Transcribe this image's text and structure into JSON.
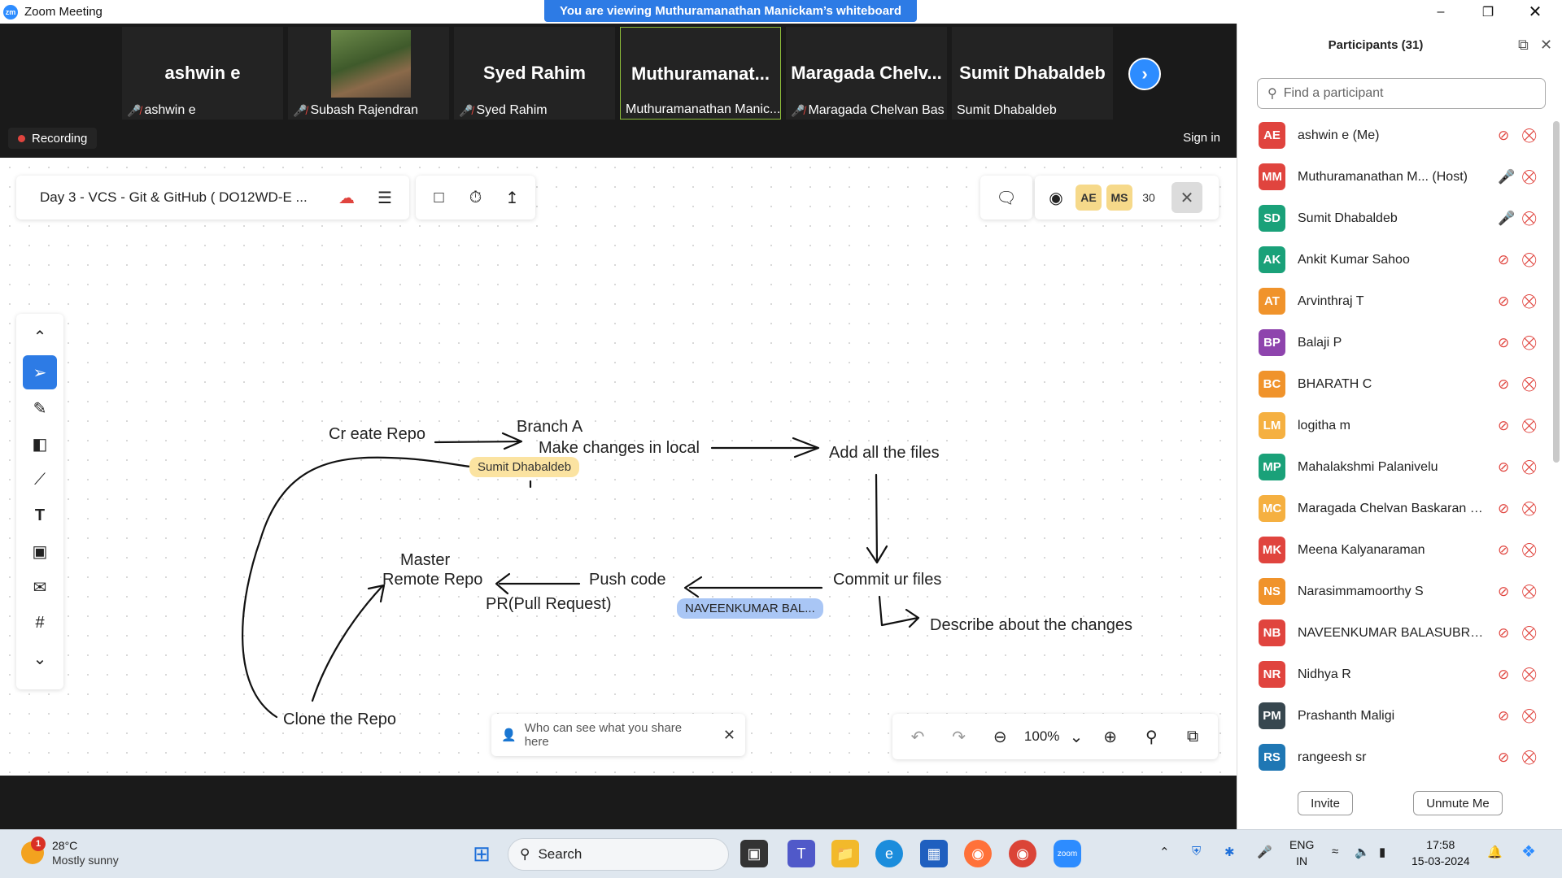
{
  "window": {
    "app_title": "Zoom Meeting",
    "banner": "You are viewing Muthuramanathan Manickam’s whiteboard"
  },
  "video_strip": {
    "tiles": [
      {
        "big": "ashwin e",
        "small": "ashwin e",
        "muted": true
      },
      {
        "big": "",
        "small": "Subash Rajendran",
        "muted": true
      },
      {
        "big": "Syed Rahim",
        "small": "Syed Rahim",
        "muted": true
      },
      {
        "big": "Muthuramanat...",
        "small": "Muthuramanathan Manic...",
        "muted": false
      },
      {
        "big": "Maragada  Chelv...",
        "small": "Maragada Chelvan Bas...",
        "muted": true
      },
      {
        "big": "Sumit Dhabaldeb",
        "small": "Sumit Dhabaldeb",
        "muted": false
      }
    ],
    "recording_label": "Recording",
    "sign_in": "Sign in"
  },
  "whiteboard": {
    "doc_title": "Day 3  - VCS - Git & GitHub ( DO12WD-E ...",
    "collaborators": [
      "AE",
      "MS"
    ],
    "collaborator_count": "30",
    "zoom_level": "100%",
    "share_notice": "Who can see what you share here",
    "drawing_texts": {
      "create_repo": "Cr eate Repo",
      "branch_a": "Branch A",
      "make_changes": "Make changes in local",
      "add_files": "Add all the files",
      "commit": "Commit ur files",
      "describe": "Describe about the changes",
      "push_code": "Push code",
      "master": "Master",
      "remote_repo": "Remote Repo",
      "pr": "PR(Pull Request)",
      "clone": "Clone the Repo"
    },
    "cursors": [
      {
        "name": "Sumit Dhabaldeb",
        "color": "#fbe3a1"
      },
      {
        "name": "NAVEENKUMAR BAL...",
        "color": "#a9c6f5"
      }
    ]
  },
  "participants": {
    "title": "Participants (31)",
    "search_placeholder": "Find a participant",
    "list": [
      {
        "initials": "AE",
        "name": "ashwin e (Me)",
        "color": "#e0443e",
        "mic": "muted"
      },
      {
        "initials": "MM",
        "name": "Muthuramanathan M...  (Host)",
        "color": "#e0443e",
        "mic": "on"
      },
      {
        "initials": "SD",
        "name": "Sumit Dhabaldeb",
        "color": "#1aa179",
        "mic": "on"
      },
      {
        "initials": "AK",
        "name": "Ankit Kumar Sahoo",
        "color": "#1aa179",
        "mic": "muted"
      },
      {
        "initials": "AT",
        "name": "Arvinthraj T",
        "color": "#f0932b",
        "mic": "muted"
      },
      {
        "initials": "BP",
        "name": "Balaji P",
        "color": "#8e44ad",
        "mic": "muted"
      },
      {
        "initials": "BC",
        "name": "BHARATH C",
        "color": "#f0932b",
        "mic": "muted"
      },
      {
        "initials": "LM",
        "name": "logitha m",
        "color": "#f5b041",
        "mic": "muted"
      },
      {
        "initials": "MP",
        "name": "Mahalakshmi Palanivelu",
        "color": "#1aa179",
        "mic": "muted"
      },
      {
        "initials": "MC",
        "name": "Maragada Chelvan Baskaran Siv...",
        "color": "#f5b041",
        "mic": "muted"
      },
      {
        "initials": "MK",
        "name": "Meena Kalyanaraman",
        "color": "#e0443e",
        "mic": "muted"
      },
      {
        "initials": "NS",
        "name": "Narasimmamoorthy S",
        "color": "#f0932b",
        "mic": "muted"
      },
      {
        "initials": "NB",
        "name": "NAVEENKUMAR BALASUBRAMA...",
        "color": "#e0443e",
        "mic": "muted"
      },
      {
        "initials": "NR",
        "name": "Nidhya R",
        "color": "#e0443e",
        "mic": "muted"
      },
      {
        "initials": "PM",
        "name": "Prashanth Maligi",
        "color": "#37474f",
        "mic": "muted"
      },
      {
        "initials": "RS",
        "name": "rangeesh sr",
        "color": "#1f77b4",
        "mic": "muted"
      }
    ],
    "invite": "Invite",
    "unmute": "Unmute Me"
  },
  "taskbar": {
    "weather_temp": "28°C",
    "weather_desc": "Mostly sunny",
    "weather_badge": "1",
    "search": "Search",
    "lang": "ENG",
    "region": "IN",
    "time": "17:58",
    "date": "15-03-2024"
  }
}
